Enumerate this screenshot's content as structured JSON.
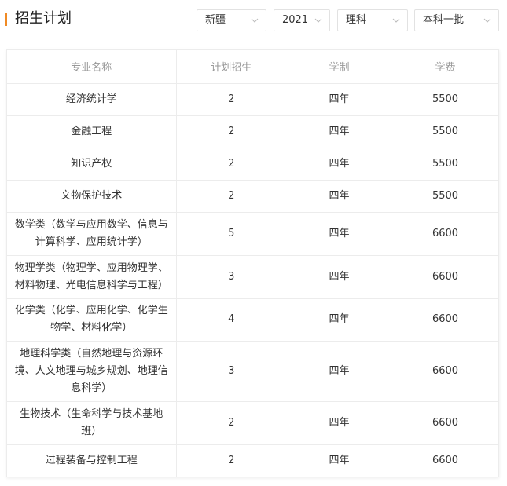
{
  "header": {
    "title": "招生计划",
    "filters": {
      "province": "新疆",
      "year": "2021",
      "subject": "理科",
      "batch": "本科一批"
    }
  },
  "table": {
    "columns": [
      "专业名称",
      "计划招生",
      "学制",
      "学费"
    ],
    "rows": [
      {
        "major": "经济统计学",
        "plan": "2",
        "length": "四年",
        "fee": "5500"
      },
      {
        "major": "金融工程",
        "plan": "2",
        "length": "四年",
        "fee": "5500"
      },
      {
        "major": "知识产权",
        "plan": "2",
        "length": "四年",
        "fee": "5500"
      },
      {
        "major": "文物保护技术",
        "plan": "2",
        "length": "四年",
        "fee": "5500"
      },
      {
        "major": "数学类（数学与应用数学、信息与计算科学、应用统计学）",
        "plan": "5",
        "length": "四年",
        "fee": "6600"
      },
      {
        "major": "物理学类（物理学、应用物理学、材料物理、光电信息科学与工程）",
        "plan": "3",
        "length": "四年",
        "fee": "6600"
      },
      {
        "major": "化学类（化学、应用化学、化学生物学、材料化学）",
        "plan": "4",
        "length": "四年",
        "fee": "6600"
      },
      {
        "major": "地理科学类（自然地理与资源环境、人文地理与城乡规划、地理信息科学）",
        "plan": "3",
        "length": "四年",
        "fee": "6600"
      },
      {
        "major": "生物技术（生命科学与技术基地班）",
        "plan": "2",
        "length": "四年",
        "fee": "6600"
      },
      {
        "major": "过程装备与控制工程",
        "plan": "2",
        "length": "四年",
        "fee": "6600"
      }
    ]
  },
  "icons": {
    "select_arrow": "chevron-down-icon"
  },
  "colors": {
    "accent": "#f08a24",
    "header_text": "#999999",
    "border": "#ececec"
  }
}
